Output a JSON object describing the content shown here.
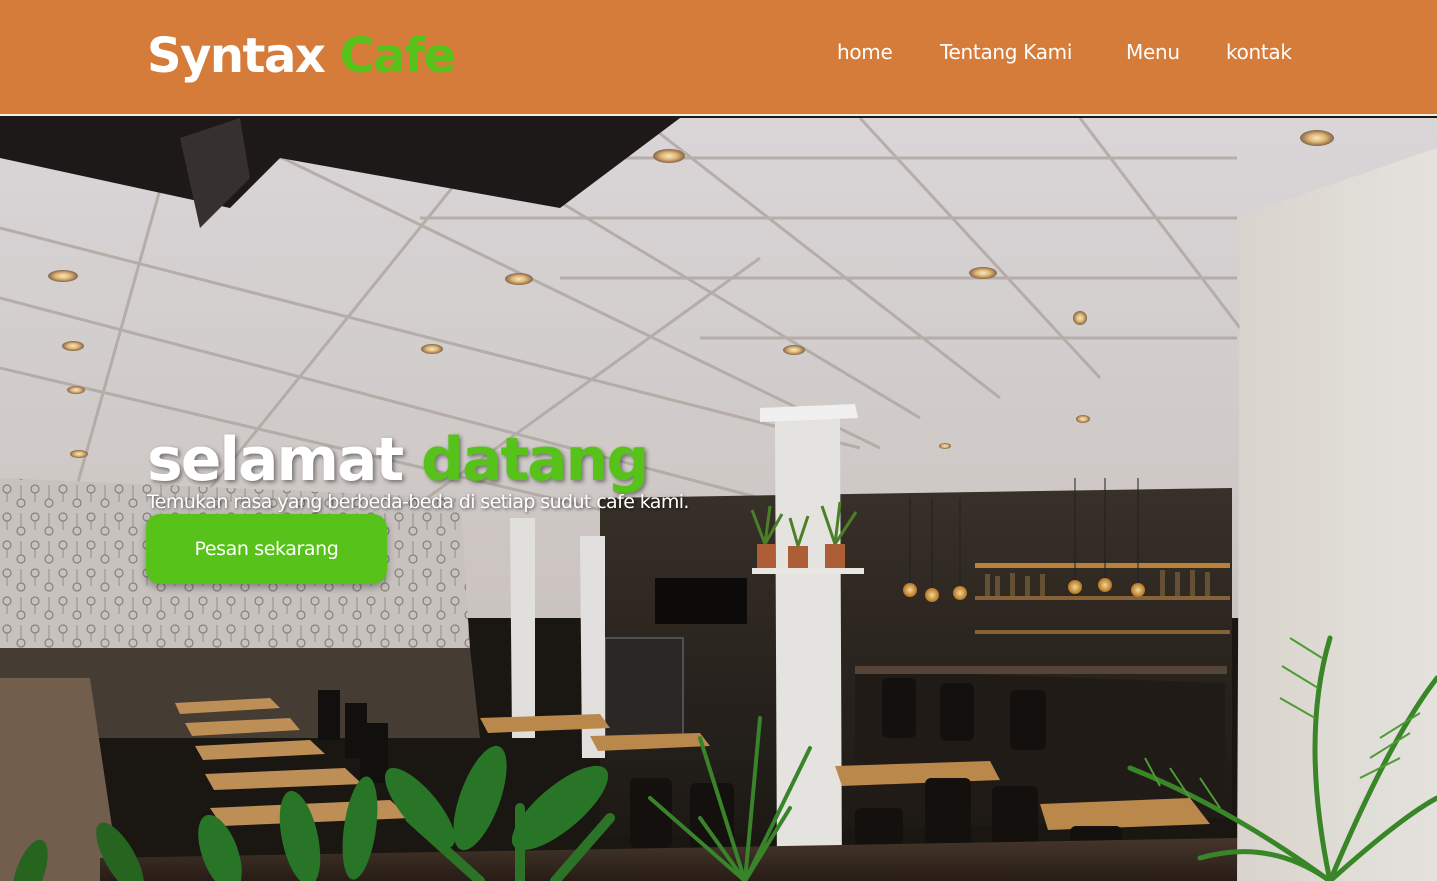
{
  "brand": {
    "name_part1": "Syntax",
    "name_part2": "Cafe"
  },
  "nav": {
    "items": [
      {
        "label": "home"
      },
      {
        "label": "Tentang Kami"
      },
      {
        "label": "Menu"
      },
      {
        "label": "kontak"
      }
    ]
  },
  "hero": {
    "title_part1": "selamat",
    "title_part2": "datang",
    "subtitle": "Temukan rasa yang berbeda-beda di setiap sudut cafe kami.",
    "cta_label": "Pesan sekarang"
  },
  "colors": {
    "navbar_bg": "#d67c3a",
    "accent_green": "#56c21a",
    "text_white": "#ffffff"
  },
  "icons": {
    "hero_background": "restaurant-interior-photo"
  }
}
